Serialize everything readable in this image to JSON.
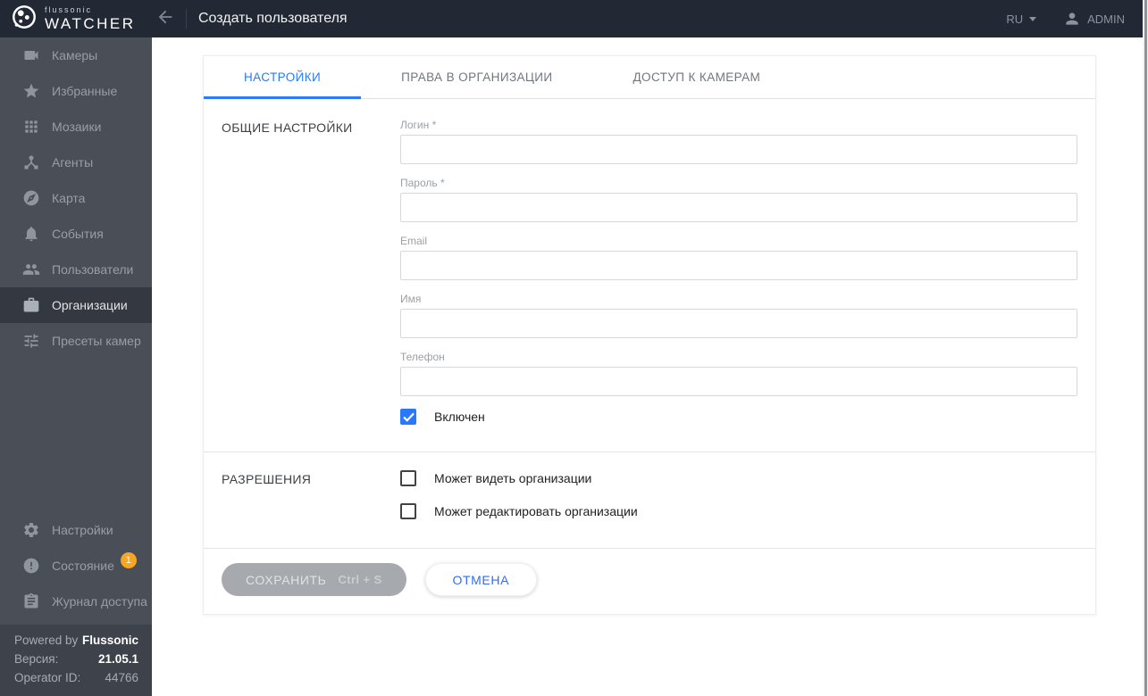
{
  "topbar": {
    "brand_top": "flussonic",
    "brand_bottom": "WATCHER",
    "page_title": "Создать пользователя",
    "language": "RU",
    "username": "ADMIN"
  },
  "sidebar": {
    "items": [
      {
        "label": "Камеры",
        "icon": "videocam-icon",
        "active": false
      },
      {
        "label": "Избранные",
        "icon": "star-icon",
        "active": false
      },
      {
        "label": "Мозаики",
        "icon": "grid-icon",
        "active": false
      },
      {
        "label": "Агенты",
        "icon": "device-hub-icon",
        "active": false
      },
      {
        "label": "Карта",
        "icon": "compass-icon",
        "active": false
      },
      {
        "label": "События",
        "icon": "bell-icon",
        "active": false
      },
      {
        "label": "Пользователи",
        "icon": "people-icon",
        "active": false
      },
      {
        "label": "Организации",
        "icon": "briefcase-icon",
        "active": true
      },
      {
        "label": "Пресеты камер",
        "icon": "tune-icon",
        "active": false
      }
    ],
    "bottom_items": [
      {
        "label": "Настройки",
        "icon": "gear-icon"
      },
      {
        "label": "Состояние",
        "icon": "alert-circle-icon",
        "badge": "1"
      },
      {
        "label": "Журнал доступа",
        "icon": "clipboard-icon"
      }
    ],
    "footer": {
      "powered_label": "Powered by",
      "powered_value": "Flussonic",
      "version_label": "Версия:",
      "version_value": "21.05.1",
      "operator_label": "Operator ID:",
      "operator_value": "44766"
    }
  },
  "tabs": [
    {
      "label": "НАСТРОЙКИ",
      "active": true
    },
    {
      "label": "ПРАВА В ОРГАНИЗАЦИИ",
      "active": false
    },
    {
      "label": "ДОСТУП К КАМЕРАМ",
      "active": false
    }
  ],
  "form": {
    "general_section_title": "ОБЩИЕ НАСТРОЙКИ",
    "fields": [
      {
        "label": "Логин *",
        "value": "",
        "required": true
      },
      {
        "label": "Пароль *",
        "value": "",
        "required": true
      },
      {
        "label": "Email",
        "value": "",
        "required": false
      },
      {
        "label": "Имя",
        "value": "",
        "required": false
      },
      {
        "label": "Телефон",
        "value": "",
        "required": false
      }
    ],
    "enabled_checkbox": {
      "label": "Включен",
      "checked": true
    },
    "permissions_section_title": "РАЗРЕШЕНИЯ",
    "permission_checkboxes": [
      {
        "label": "Может видеть организации",
        "checked": false
      },
      {
        "label": "Может редактировать организации",
        "checked": false
      }
    ],
    "buttons": {
      "save_label": "СОХРАНИТЬ",
      "save_shortcut": "Ctrl + S",
      "save_disabled": true,
      "cancel_label": "ОТМЕНА"
    }
  },
  "colors": {
    "accent_blue": "#2b7bf6",
    "checkbox_blue": "#2979ff",
    "badge_orange": "#f5a623",
    "topbar_bg": "#222934",
    "sidebar_bg": "#4a4e57",
    "sidebar_active_bg": "#343841",
    "sidebar_footer_bg": "#3e424a",
    "disabled_button_bg": "#a6a9ae"
  }
}
